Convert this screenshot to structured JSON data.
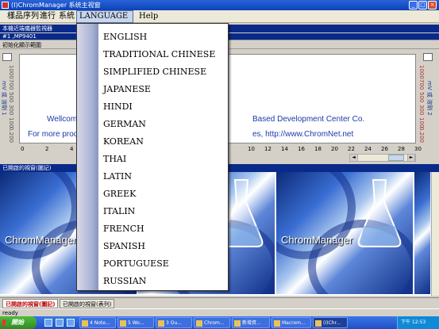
{
  "window": {
    "title": "(I)ChromManager 系统主视窗",
    "icon": "app-icon"
  },
  "menubar": {
    "items": [
      {
        "label": "樣品序列"
      },
      {
        "label": "進行"
      },
      {
        "label": "系統"
      },
      {
        "label": "LANGUAGE"
      },
      {
        "label": "Help"
      }
    ]
  },
  "language_menu": {
    "items": [
      "ENGLISH",
      "TRADITIONAL CHINESE",
      "SIMPLIFIED CHINESE",
      "JAPANESE",
      "HINDI",
      "GERMAN",
      "KOREAN",
      "THAI",
      "LATIN",
      "GREEK",
      "ITALIN",
      "FRENCH",
      "SPANISH",
      "PORTUGUESE",
      "RUSSIAN"
    ]
  },
  "monitor_header": "本機近端儀器監視器",
  "instrument_row": "#1 ,MP9401",
  "init_row": "初始化顯示範圍",
  "chart": {
    "left_axis_ticks": [
      "1000",
      "700",
      "500",
      "300",
      "100",
      "0.200"
    ],
    "left_axis_label": "mV 或 溶劑 1",
    "right_axis_ticks": [
      "1000",
      "700",
      "500",
      "300",
      "100",
      "0.200"
    ],
    "right_axis_label": "mV 或 溶劑 2",
    "welcome_line1_left": "Wellcome to u",
    "welcome_line1_right": "Based Development Center Co.",
    "welcome_line2_left": "For more prod",
    "welcome_line2_right": "es, http://www.ChromNet.net",
    "x_ticks_left": [
      "0",
      "2",
      "4"
    ],
    "x_ticks_right": [
      "10",
      "12",
      "14",
      "16",
      "18",
      "20",
      "22",
      "24",
      "26",
      "28",
      "30"
    ]
  },
  "lower_header": "已開啟的視窗(圖記)",
  "tile_brand": "ChromManager",
  "tabs": [
    {
      "label": "已開啟的視窗(圖記)",
      "active": true
    },
    {
      "label": "已開啟的視窗(表列)",
      "active": false
    }
  ],
  "status": "ready",
  "taskbar": {
    "start_label": "開始",
    "tasks": [
      {
        "label": "4 Note..."
      },
      {
        "label": "5 Wo..."
      },
      {
        "label": "3 Ou..."
      },
      {
        "label": "Chrom..."
      },
      {
        "label": "新增資..."
      },
      {
        "label": "Macrom..."
      },
      {
        "label": "(I)Chr...",
        "active": true
      }
    ],
    "clock": "下午 12:53"
  },
  "colors": {
    "title_blue": "#0a43b8",
    "accent_blue": "#1b3aaa",
    "menu_highlight": "#c8d6ee",
    "active_tab_text": "#b00000"
  }
}
